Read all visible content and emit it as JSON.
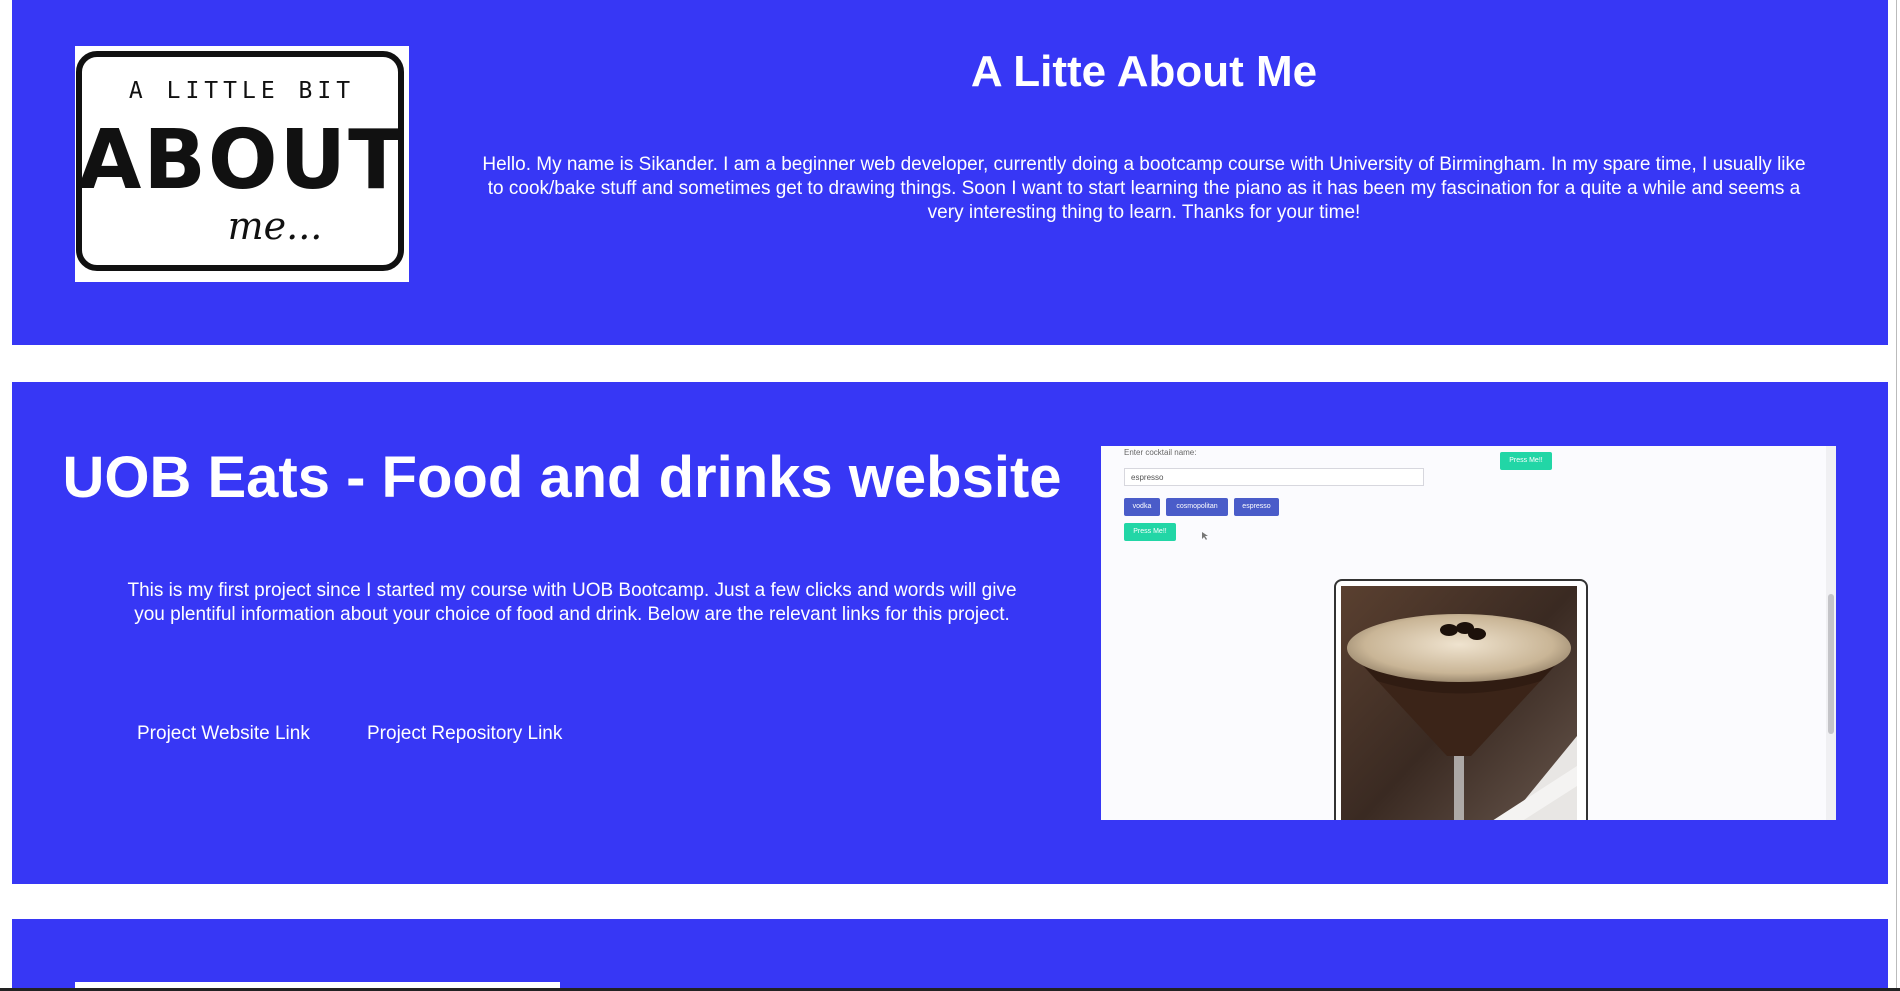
{
  "colors": {
    "panel_background": "#3737f5",
    "text": "#ffffff",
    "preview_button_green": "#22d6a6",
    "preview_chip_blue": "#4a5cc9"
  },
  "about": {
    "image_alt": "A LITTLE BIT ABOUT me...",
    "title": "A Litte About Me",
    "text": "Hello. My name is Sikander. I am a beginner web developer, currently doing a bootcamp course with University of Birmingham. In my spare time, I usually like to cook/bake stuff and sometimes get to drawing things. Soon I want to start learning the piano as it has been my fascination for a quite a while and seems a very interesting thing to learn. Thanks for your time!"
  },
  "project": {
    "title": "UOB Eats - Food and drinks website",
    "description": "This is my first project since I started my course with UOB Bootcamp. Just a few clicks and words will give you plentiful information about your choice of food and drink. Below are the relevant links for this project.",
    "links": [
      "Project Website Link",
      "Project Repository Link"
    ],
    "preview": {
      "label": "Enter cocktail name:",
      "input_value": "espresso",
      "top_button": "Press Me!!",
      "chips": [
        "vodka",
        "cosmopolitan",
        "espresso"
      ],
      "button": "Press Me!!",
      "photo_alt": "espresso martini"
    }
  }
}
